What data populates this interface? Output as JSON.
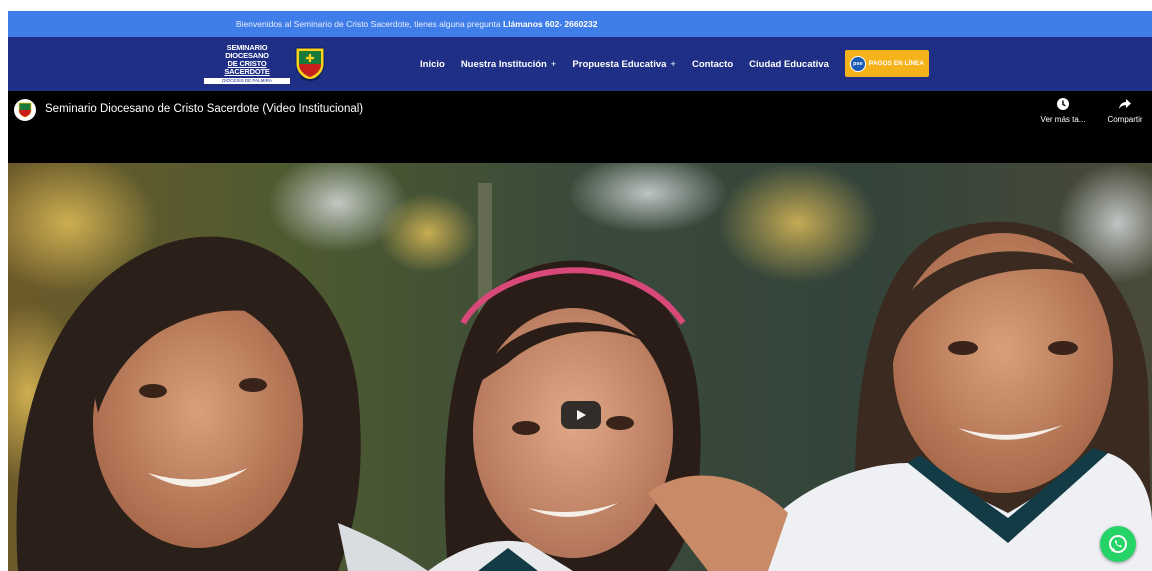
{
  "topbar": {
    "text": "Bienvenidos al Seminario de Cristo Sacerdote, tienes alguna pregunta ",
    "phone": "Llámanos 602- 2660232"
  },
  "logo": {
    "line1": "SEMINARIO DIOCESANO",
    "line2": "DE CRISTO SACERDOTE",
    "line3": "DIÓCESIS DE PALMIRA"
  },
  "nav": {
    "items": [
      {
        "label": "Inicio",
        "has_submenu": false
      },
      {
        "label": "Nuestra Institución",
        "has_submenu": true
      },
      {
        "label": "Propuesta Educativa",
        "has_submenu": true
      },
      {
        "label": "Contacto",
        "has_submenu": false
      },
      {
        "label": "Ciudad Educativa",
        "has_submenu": false
      }
    ],
    "submenu_marker": "+",
    "payments": {
      "logo_text": "pse",
      "label": "PAGOS EN LÍNEA"
    }
  },
  "video": {
    "title": "Seminario Diocesano de Cristo Sacerdote (Video Institucional)",
    "watch_later_label": "Ver más ta...",
    "share_label": "Compartir"
  },
  "colors": {
    "topbar": "#3f7ee8",
    "navbar": "#1f2f86",
    "payments_button": "#f6b21b",
    "whatsapp": "#25d366"
  },
  "icons": {
    "watch_later": "clock-icon",
    "share": "share-arrow-icon",
    "play": "play-icon",
    "whatsapp": "whatsapp-icon"
  }
}
